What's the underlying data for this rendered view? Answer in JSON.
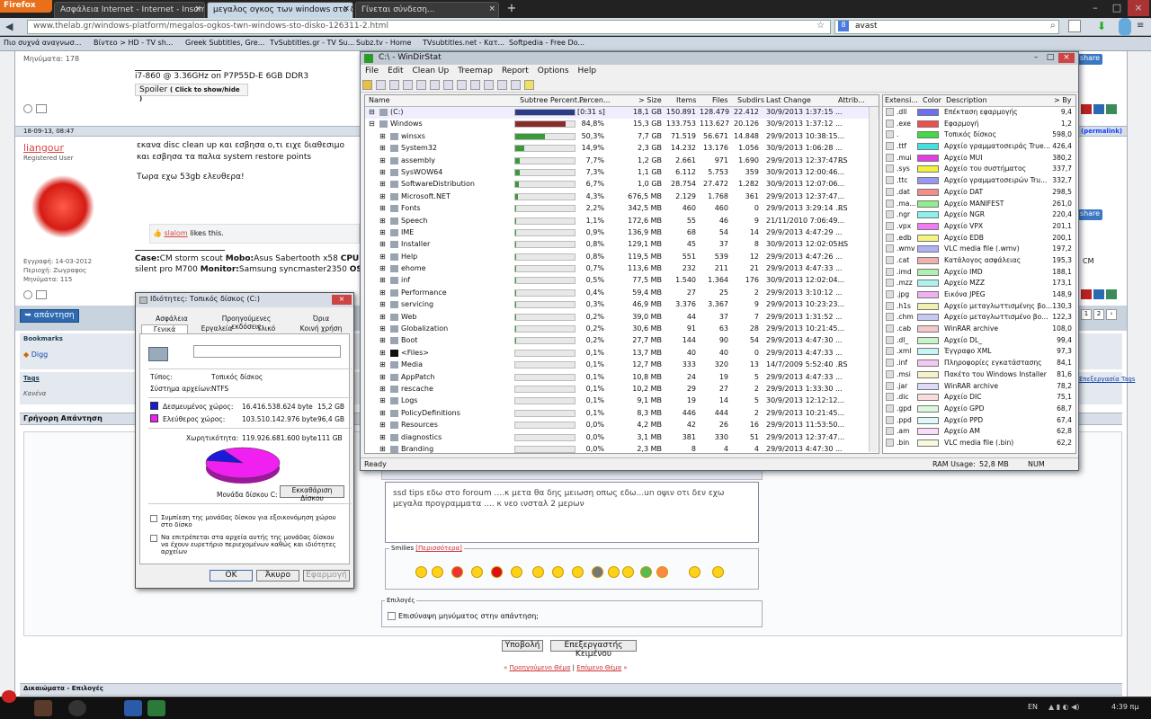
{
  "browser": {
    "firefox_label": "Firefox",
    "tabs": [
      {
        "label": "Ασφάλεια Internet - Internet - Insomni...",
        "active": false
      },
      {
        "label": "μεγαλος ογκος των windows στο δισκο...",
        "active": true
      },
      {
        "label": "Γίνεται σύνδεση...",
        "active": false
      }
    ],
    "url": "www.thelab.gr/windows-platform/megalos-ogkos-twn-windows-sto-disko-126311-2.html",
    "search_value": "avast",
    "bookmarks": [
      "Πιο συχνά αναγνωσ...",
      "Βίντεο > HD - TV sh...",
      "Greek Subtitles, Gre...",
      "TvSubtitles.gr - TV Su...",
      "Subz.tv - Home",
      "TVsubtitles.net - Κατ...",
      "Softpedia - Free Do..."
    ]
  },
  "forum": {
    "prev_post_messages": "Μηνύματα: 178",
    "prev_sig_cpu": "i7-860 @ 3.36GHz on P7P55D-E 6GB DDR3",
    "spoiler_label": "Spoiler",
    "spoiler_hint": "( Click to show/hide )",
    "post_date": "18-09-13, 08:47",
    "permalink": "(permalink)",
    "username": "liangour",
    "user_role": "Registered User",
    "post_text_1": "εκανα disc clean up και εσβησα ο,τι ειχε διαθεσιμο",
    "post_text_2": "και εσβησα τα παλια system restore points",
    "post_text_3": "Τωρα εχω 53gb ελευθερα!",
    "likes_user": "slalom",
    "likes_text": " likes this.",
    "reg_date": "Εγγραφή: 14-03-2012",
    "location": "Περιοχή: Ζωγραφος",
    "messages": "Μηνύματα: 115",
    "sig_line1_case_label": "Case:",
    "sig_line1_case": "CM storm scout ",
    "sig_line1_mobo_label": "Mobo:",
    "sig_line1_mobo": "Asus Sabertooth x58 ",
    "sig_line1_cpu_label": "CPU:",
    "sig_line2": "silent pro M700 ",
    "sig_line2_monitor_label": "Monitor:",
    "sig_line2_monitor": "Samsung syncmaster2350 ",
    "sig_line2_os_label": "OS:",
    "share_label": "share",
    "cm_label": "CM",
    "reply_button": "απάντηση",
    "pages": [
      "1",
      "2"
    ],
    "bookmarks_heading": "Bookmarks",
    "digg": "Digg",
    "tags_heading": "Tags",
    "tags_none": "Κανένα",
    "tags_edit": "Επεξεργασία Tags",
    "quick_reply": "Γρήγορη Απάντηση",
    "reply_text_1": "ssd tips  εδω στο foroum ....κ μετα θα δης μειωση  οπως εδω...un οψιν  οτι δεν εχω",
    "reply_text_2": "μεγαλα προγραμματα .... κ νεο ινσταλ 2 μερων",
    "smilies_label": "Smilies",
    "smilies_more": "[Περισσότερα]",
    "options_label": "Επιλογές",
    "quote_option": "Επισύναψη μηνύματος στην απάντηση;",
    "post_reply_button": "Υποβολή",
    "advanced_button": "Επεξεργαστής Κειμένου",
    "prev_thread": "Προηγούμενο Θέμα",
    "next_thread": "Επόμενο Θέμα",
    "separator": "|",
    "permissions": "Δικαιώματα - Επιλογές"
  },
  "windirstat": {
    "title": "C:\\ - WinDirStat",
    "menu": [
      "File",
      "Edit",
      "Clean Up",
      "Treemap",
      "Report",
      "Options",
      "Help"
    ],
    "columns": [
      "Name",
      "Subtree Percent...",
      "Percen...",
      "> Size",
      "Items",
      "Files",
      "Subdirs",
      "Last Change",
      "Attrib..."
    ],
    "rows": [
      {
        "name": "(C:)",
        "pct": "[0:31 s]",
        "size": "18,1 GB",
        "items": "150.891",
        "files": "128.479",
        "subdirs": "22.412",
        "change": "30/9/2013  1:37:15 ...",
        "attr": "",
        "bar": 1.0,
        "color": "#2b3b8a"
      },
      {
        "name": "Windows",
        "pct": "84,8%",
        "size": "15,3 GB",
        "items": "133.753",
        "files": "113.627",
        "subdirs": "20.126",
        "change": "30/9/2013  1:37:12 ...",
        "attr": "",
        "bar": 0.848,
        "color": "#8a2b2b"
      },
      {
        "name": "winsxs",
        "pct": "50,3%",
        "size": "7,7 GB",
        "items": "71.519",
        "files": "56.671",
        "subdirs": "14.848",
        "change": "29/9/2013  10:38:15...",
        "attr": "",
        "bar": 0.503,
        "color": "#3a9a3a"
      },
      {
        "name": "System32",
        "pct": "14,9%",
        "size": "2,3 GB",
        "items": "14.232",
        "files": "13.176",
        "subdirs": "1.056",
        "change": "30/9/2013  1:06:28 ...",
        "attr": "",
        "bar": 0.149,
        "color": "#3a9a3a"
      },
      {
        "name": "assembly",
        "pct": "7,7%",
        "size": "1,2 GB",
        "items": "2.661",
        "files": "971",
        "subdirs": "1.690",
        "change": "29/9/2013  12:37:47...",
        "attr": "RS",
        "bar": 0.077,
        "color": "#3a9a3a"
      },
      {
        "name": "SysWOW64",
        "pct": "7,3%",
        "size": "1,1 GB",
        "items": "6.112",
        "files": "5.753",
        "subdirs": "359",
        "change": "30/9/2013  12:00:46...",
        "attr": "",
        "bar": 0.073,
        "color": "#3a9a3a"
      },
      {
        "name": "SoftwareDistribution",
        "pct": "6,7%",
        "size": "1,0 GB",
        "items": "28.754",
        "files": "27.472",
        "subdirs": "1.282",
        "change": "30/9/2013  12:07:06...",
        "attr": "",
        "bar": 0.067,
        "color": "#3a9a3a"
      },
      {
        "name": "Microsoft.NET",
        "pct": "4,3%",
        "size": "676,5 MB",
        "items": "2.129",
        "files": "1.768",
        "subdirs": "361",
        "change": "29/9/2013  12:37:47...",
        "attr": "",
        "bar": 0.043,
        "color": "#3a9a3a"
      },
      {
        "name": "Fonts",
        "pct": "2,2%",
        "size": "342,5 MB",
        "items": "460",
        "files": "460",
        "subdirs": "0",
        "change": "29/9/2013  3:29:14 ...",
        "attr": "RS",
        "bar": 0.022,
        "color": "#3a9a3a"
      },
      {
        "name": "Speech",
        "pct": "1,1%",
        "size": "172,6 MB",
        "items": "55",
        "files": "46",
        "subdirs": "9",
        "change": "21/11/2010  7:06:49...",
        "attr": "",
        "bar": 0.011,
        "color": "#3a9a3a"
      },
      {
        "name": "IME",
        "pct": "0,9%",
        "size": "136,9 MB",
        "items": "68",
        "files": "54",
        "subdirs": "14",
        "change": "29/9/2013  4:47:29 ...",
        "attr": "",
        "bar": 0.009,
        "color": "#3a9a3a"
      },
      {
        "name": "Installer",
        "pct": "0,8%",
        "size": "129,1 MB",
        "items": "45",
        "files": "37",
        "subdirs": "8",
        "change": "30/9/2013  12:02:05...",
        "attr": "HS",
        "bar": 0.008,
        "color": "#3a9a3a"
      },
      {
        "name": "Help",
        "pct": "0,8%",
        "size": "119,5 MB",
        "items": "551",
        "files": "539",
        "subdirs": "12",
        "change": "29/9/2013  4:47:26 ...",
        "attr": "",
        "bar": 0.008,
        "color": "#3a9a3a"
      },
      {
        "name": "ehome",
        "pct": "0,7%",
        "size": "113,6 MB",
        "items": "232",
        "files": "211",
        "subdirs": "21",
        "change": "29/9/2013  4:47:33 ...",
        "attr": "",
        "bar": 0.007,
        "color": "#3a9a3a"
      },
      {
        "name": "inf",
        "pct": "0,5%",
        "size": "77,5 MB",
        "items": "1.540",
        "files": "1.364",
        "subdirs": "176",
        "change": "30/9/2013  12:02:04...",
        "attr": "",
        "bar": 0.005,
        "color": "#3a9a3a"
      },
      {
        "name": "Performance",
        "pct": "0,4%",
        "size": "59,4 MB",
        "items": "27",
        "files": "25",
        "subdirs": "2",
        "change": "29/9/2013  3:10:12 ...",
        "attr": "",
        "bar": 0.004,
        "color": "#3a9a3a"
      },
      {
        "name": "servicing",
        "pct": "0,3%",
        "size": "46,9 MB",
        "items": "3.376",
        "files": "3.367",
        "subdirs": "9",
        "change": "29/9/2013  10:23:23...",
        "attr": "",
        "bar": 0.003,
        "color": "#3a9a3a"
      },
      {
        "name": "Web",
        "pct": "0,2%",
        "size": "39,0 MB",
        "items": "44",
        "files": "37",
        "subdirs": "7",
        "change": "29/9/2013  1:31:52 ...",
        "attr": "",
        "bar": 0.002,
        "color": "#3a9a3a"
      },
      {
        "name": "Globalization",
        "pct": "0,2%",
        "size": "30,6 MB",
        "items": "91",
        "files": "63",
        "subdirs": "28",
        "change": "29/9/2013  10:21:45...",
        "attr": "",
        "bar": 0.002,
        "color": "#3a9a3a"
      },
      {
        "name": "Boot",
        "pct": "0,2%",
        "size": "27,7 MB",
        "items": "144",
        "files": "90",
        "subdirs": "54",
        "change": "29/9/2013  4:47:30 ...",
        "attr": "",
        "bar": 0.002,
        "color": "#3a9a3a"
      },
      {
        "name": "<Files>",
        "pct": "0,1%",
        "size": "13,7 MB",
        "items": "40",
        "files": "40",
        "subdirs": "0",
        "change": "29/9/2013  4:47:33 ...",
        "attr": "",
        "bar": 0.001,
        "color": "#3a9a3a"
      },
      {
        "name": "Media",
        "pct": "0,1%",
        "size": "12,7 MB",
        "items": "333",
        "files": "320",
        "subdirs": "13",
        "change": "14/7/2009  5:52:40 ...",
        "attr": "RS",
        "bar": 0.001,
        "color": "#3a9a3a"
      },
      {
        "name": "AppPatch",
        "pct": "0,1%",
        "size": "10,8 MB",
        "items": "24",
        "files": "19",
        "subdirs": "5",
        "change": "29/9/2013  4:47:33 ...",
        "attr": "",
        "bar": 0.001,
        "color": "#3a9a3a"
      },
      {
        "name": "rescache",
        "pct": "0,1%",
        "size": "10,2 MB",
        "items": "29",
        "files": "27",
        "subdirs": "2",
        "change": "29/9/2013  1:33:30 ...",
        "attr": "",
        "bar": 0.001,
        "color": "#3a9a3a"
      },
      {
        "name": "Logs",
        "pct": "0,1%",
        "size": "9,1 MB",
        "items": "19",
        "files": "14",
        "subdirs": "5",
        "change": "30/9/2013  12:12:12...",
        "attr": "",
        "bar": 0.001,
        "color": "#3a9a3a"
      },
      {
        "name": "PolicyDefinitions",
        "pct": "0,1%",
        "size": "8,3 MB",
        "items": "446",
        "files": "444",
        "subdirs": "2",
        "change": "29/9/2013  10:21:45...",
        "attr": "",
        "bar": 0.001,
        "color": "#3a9a3a"
      },
      {
        "name": "Resources",
        "pct": "0,0%",
        "size": "4,2 MB",
        "items": "42",
        "files": "26",
        "subdirs": "16",
        "change": "29/9/2013  11:53:50...",
        "attr": "",
        "bar": 0.0,
        "color": "#3a9a3a"
      },
      {
        "name": "diagnostics",
        "pct": "0,0%",
        "size": "3,1 MB",
        "items": "381",
        "files": "330",
        "subdirs": "51",
        "change": "29/9/2013  12:37:47...",
        "attr": "",
        "bar": 0.0,
        "color": "#3a9a3a"
      },
      {
        "name": "Branding",
        "pct": "0,0%",
        "size": "2,3 MB",
        "items": "8",
        "files": "4",
        "subdirs": "4",
        "change": "29/9/2013  4:47:30 ...",
        "attr": "",
        "bar": 0.0,
        "color": "#3a9a3a"
      }
    ],
    "ext_columns": [
      "Extensi...",
      "Color",
      "Description",
      "> By"
    ],
    "extensions": [
      {
        "ext": ".dll",
        "color": "#6e6ef0",
        "desc": "Επέκταση εφαρμογής",
        "bytes": "9,4"
      },
      {
        "ext": ".exe",
        "color": "#ef4e4e",
        "desc": "Εφαρμογή",
        "bytes": "1,2"
      },
      {
        "ext": ".",
        "color": "#44d844",
        "desc": "Τοπικός δίσκος",
        "bytes": "598,0"
      },
      {
        "ext": ".ttf",
        "color": "#44e0e0",
        "desc": "Αρχείο γραμματοσειράς True...",
        "bytes": "426,4"
      },
      {
        "ext": ".mui",
        "color": "#e040e0",
        "desc": "Αρχείο MUI",
        "bytes": "380,2"
      },
      {
        "ext": ".sys",
        "color": "#f0f040",
        "desc": "Αρχείο του συστήματος",
        "bytes": "337,7"
      },
      {
        "ext": ".ttc",
        "color": "#9898f4",
        "desc": "Αρχείο γραμματοσειρών Tru...",
        "bytes": "332,7"
      },
      {
        "ext": ".dat",
        "color": "#f48c8c",
        "desc": "Αρχείο DAT",
        "bytes": "298,5"
      },
      {
        "ext": ".ma...",
        "color": "#90ee90",
        "desc": "Αρχείο MANIFEST",
        "bytes": "261,0"
      },
      {
        "ext": ".ngr",
        "color": "#8cf0f0",
        "desc": "Αρχείο NGR",
        "bytes": "220,4"
      },
      {
        "ext": ".vpx",
        "color": "#f07cf0",
        "desc": "Αρχείο VPX",
        "bytes": "201,1"
      },
      {
        "ext": ".edb",
        "color": "#f4f480",
        "desc": "Αρχείο EDB",
        "bytes": "200,1"
      },
      {
        "ext": ".wmv",
        "color": "#b0b0f4",
        "desc": "VLC media file (.wmv)",
        "bytes": "197,2"
      },
      {
        "ext": ".cat",
        "color": "#f0b0b0",
        "desc": "Κατάλογος ασφάλειας",
        "bytes": "195,3"
      },
      {
        "ext": ".imd",
        "color": "#b0f0b0",
        "desc": "Αρχείο IMD",
        "bytes": "188,1"
      },
      {
        "ext": ".mzz",
        "color": "#b0f0f0",
        "desc": "Αρχείο MZZ",
        "bytes": "173,1"
      },
      {
        "ext": ".jpg",
        "color": "#f0b0f0",
        "desc": "Εικόνα JPEG",
        "bytes": "148,9"
      },
      {
        "ext": ".h1s",
        "color": "#f0f0b0",
        "desc": "Αρχείο μεταγλωττισμένης βο...",
        "bytes": "130,3"
      },
      {
        "ext": ".chm",
        "color": "#c8c8f4",
        "desc": "Αρχείο μεταγλωττισμένο βο...",
        "bytes": "122,3"
      },
      {
        "ext": ".cab",
        "color": "#f4c8c8",
        "desc": "WinRAR archive",
        "bytes": "108,0"
      },
      {
        "ext": ".dl_",
        "color": "#c8f4c8",
        "desc": "Αρχείο DL_",
        "bytes": "99,4"
      },
      {
        "ext": ".xml",
        "color": "#c8f4f4",
        "desc": "Έγγραφο XML",
        "bytes": "97,3"
      },
      {
        "ext": ".inf",
        "color": "#f4c8f4",
        "desc": "Πληροφορίες εγκατάστασης",
        "bytes": "84,1"
      },
      {
        "ext": ".msi",
        "color": "#f4f4c8",
        "desc": "Πακέτο του Windows Installer",
        "bytes": "81,6"
      },
      {
        "ext": ".jar",
        "color": "#dcdcf8",
        "desc": "WinRAR archive",
        "bytes": "78,2"
      },
      {
        "ext": ".dic",
        "color": "#f8dcdc",
        "desc": "Αρχείο DIC",
        "bytes": "75,1"
      },
      {
        "ext": ".gpd",
        "color": "#dcf8dc",
        "desc": "Αρχείο GPD",
        "bytes": "68,7"
      },
      {
        "ext": ".ppd",
        "color": "#dcf8f8",
        "desc": "Αρχείο PPD",
        "bytes": "67,4"
      },
      {
        "ext": ".am",
        "color": "#f8dcf8",
        "desc": "Αρχείο AM",
        "bytes": "62,8"
      },
      {
        "ext": ".bin",
        "color": "#f8f8dc",
        "desc": "VLC media file (.bin)",
        "bytes": "62,2"
      }
    ],
    "status_ready": "Ready",
    "ram_label": "RAM Usage:",
    "ram_value": "52,8 MB",
    "num": "NUM"
  },
  "properties": {
    "title": "Ιδιότητες: Τοπικός δίσκος (C:)",
    "tabs_row1": [
      "Ασφάλεια",
      "Προηγούμενες εκδόσεις",
      "Όρια"
    ],
    "tabs_row2": [
      "Γενικά",
      "Εργαλεία",
      "Υλικό",
      "Κοινή χρήση"
    ],
    "type_label": "Τύπος:",
    "type_value": "Τοπικός δίσκος",
    "fs_label": "Σύστημα αρχείων:",
    "fs_value": "NTFS",
    "used_label": "Δεσμευμένος χώρος:",
    "used_bytes": "16.416.538.624 byte",
    "used_gb": "15,2 GB",
    "free_label": "Ελεύθερος χώρος:",
    "free_bytes": "103.510.142.976 byte",
    "free_gb": "96,4 GB",
    "cap_label": "Χωρητικότητα:",
    "cap_bytes": "119.926.681.600 byte",
    "cap_gb": "111 GB",
    "used_fraction": 0.137,
    "used_color": "#1a1ad8",
    "free_color": "#f020f0",
    "drive_label": "Μονάδα δίσκου C:",
    "cleanup_button": "Εκκαθάριση Δίσκου",
    "compress_label": "Συμπίεση της μονάδας δίσκου για εξοικονόμηση χώρου στο δίσκο",
    "index_label": "Να επιτρέπεται στα αρχεία αυτής της μονάδας δίσκου να έχουν ευρετήριο περιεχομένων καθώς και ιδιότητες αρχείων",
    "ok": "OK",
    "cancel": "Άκυρο",
    "apply": "Εφαρμογή"
  },
  "taskbar": {
    "lang": "EN",
    "time": "4:39 πμ"
  }
}
